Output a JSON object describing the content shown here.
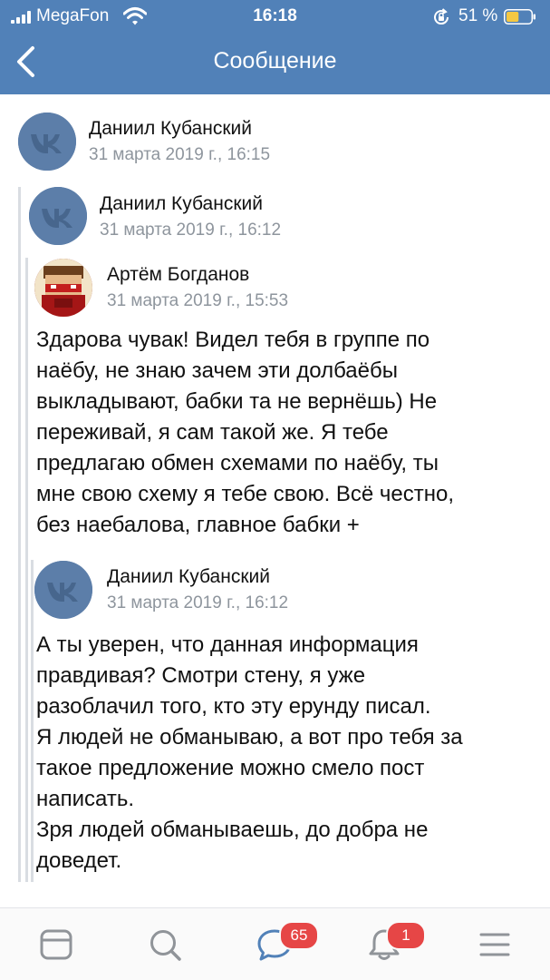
{
  "status_bar": {
    "carrier": "MegaFon",
    "time": "16:18",
    "battery_percent": "51 %",
    "battery_level": 0.51
  },
  "nav": {
    "title": "Сообщение",
    "back_icon": "chevron-left-icon"
  },
  "message": {
    "author": "Даниил Кубанский",
    "date": "31 марта 2019 г., 16:15",
    "forwarded": {
      "author": "Даниил Кубанский",
      "date": "31 марта 2019 г., 16:12",
      "messages": [
        {
          "author": "Артём Богданов",
          "date": "31 марта 2019 г., 15:53",
          "lines": [
            "Здарова чувак! Видел тебя в группе по",
            "наёбу, не знаю зачем эти долбаёбы",
            "выкладывают, бабки та не вернёшь) Не",
            "переживай, я сам такой же. Я тебе",
            "предлагаю обмен схемами по наёбу, ты",
            "мне свою схему я тебе свою. Всё честно,",
            "без наебалова, главное бабки +"
          ]
        },
        {
          "author": "Даниил Кубанский",
          "date": "31 марта 2019 г., 16:12",
          "lines": [
            "А ты уверен, что данная информация",
            "правдивая? Смотри стену, я уже",
            "разоблачил того, кто эту ерунду писал.",
            "Я людей не обманываю, а вот про тебя за",
            "такое предложение можно смело пост",
            "написать.",
            "Зря людей обманываешь, до добра не",
            "доведет."
          ]
        }
      ]
    }
  },
  "tab_bar": {
    "tabs": [
      {
        "name": "news",
        "icon": "newsfeed-icon"
      },
      {
        "name": "search",
        "icon": "search-icon"
      },
      {
        "name": "messages",
        "icon": "messages-icon",
        "badge": "65"
      },
      {
        "name": "notifications",
        "icon": "bell-icon",
        "badge": "1"
      },
      {
        "name": "menu",
        "icon": "menu-icon"
      }
    ]
  },
  "colors": {
    "header": "#5181b8",
    "avatar_placeholder": "#5c7ea9",
    "date_text": "#8e959d",
    "badge": "#e64646",
    "tab_icon": "#909499"
  }
}
